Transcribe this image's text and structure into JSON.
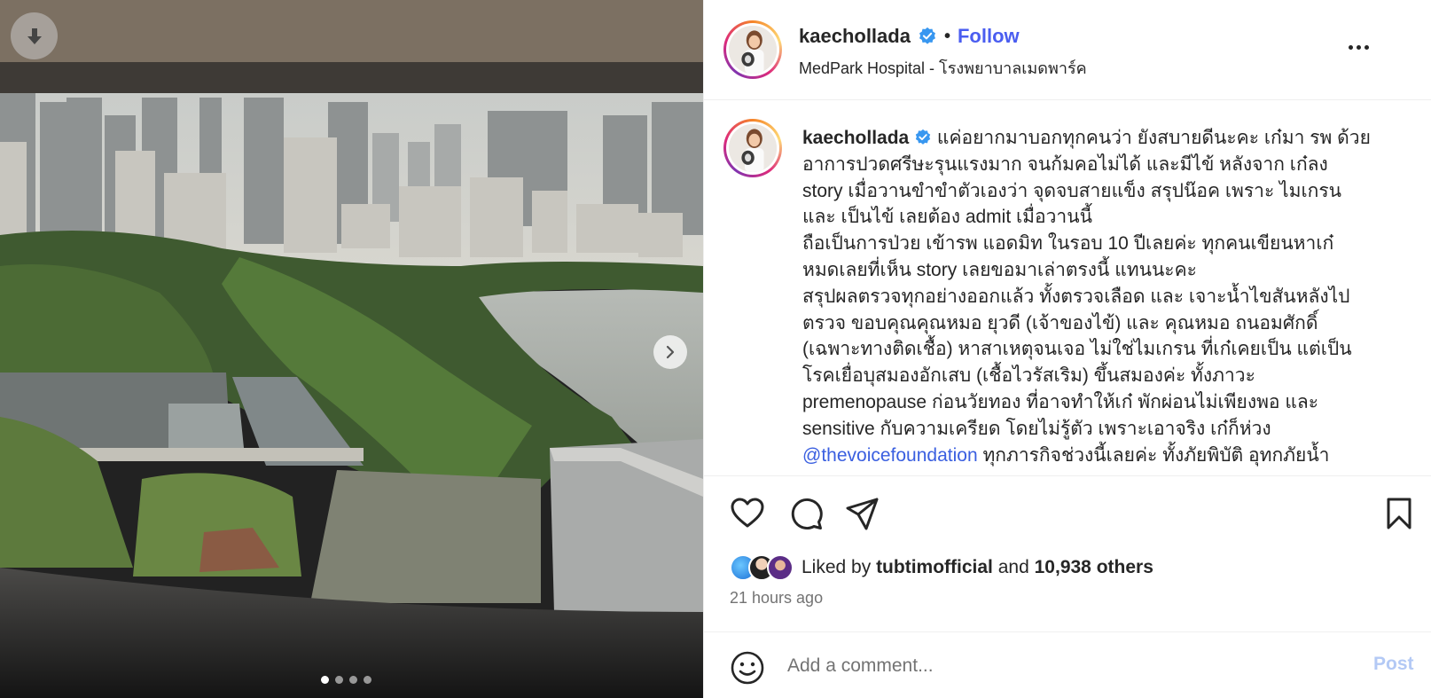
{
  "media": {
    "download_icon": "download-arrow-icon",
    "next_icon": "chevron-right-icon",
    "slide_count": 4,
    "active_slide": 1
  },
  "header": {
    "username": "kaechollada",
    "verified": true,
    "separator": "•",
    "follow_label": "Follow",
    "location": "MedPark Hospital - โรงพยาบาลเมดพาร์ค",
    "more_icon": "more-options-icon"
  },
  "caption": {
    "username": "kaechollada",
    "lines": [
      "แค่อยากมาบอกทุกคนว่า ยังสบายดีนะคะ เก๋มา รพ ด้วย",
      "อาการปวดศรีษะรุนแรงมาก จนก้มคอไม่ได้ และมีไข้ หลังจาก เก๋ลง",
      "story เมื่อวานขำขำตัวเองว่า จุดจบสายแข็ง สรุปน๊อค เพราะ ไมเกรน",
      "และ เป็นไข้ เลยต้อง admit เมื่อวานนี้",
      "ถือเป็นการป่วย เข้ารพ แอดมิท ในรอบ 10 ปีเลยค่ะ ทุกคนเขียนหาเก๋",
      "หมดเลยที่เห็น story เลยขอมาเล่าตรงนี้ แทนนะคะ",
      "สรุปผลตรวจทุกอย่างออกแล้ว ทั้งตรวจเลือด และ เจาะน้ำไขสันหลังไป",
      "ตรวจ ขอบคุณคุณหมอ ยุวดี (เจ้าของไข้) และ คุณหมอ ถนอมศักดิ์",
      "(เฉพาะทางติดเชื้อ) หาสาเหตุจนเจอ ไม่ใช่ไมเกรน ที่เก๋เคยเป็น แต่เป็น",
      "โรคเยื่อบุสมองอักเสบ (เชื้อไวรัสเริม) ขึ้นสมองค่ะ ทั้งภาวะ",
      "premenopause ก่อนวัยทอง ที่อาจทำให้เก๋ พักผ่อนไม่เพียงพอ และ",
      "sensitive กับความเครียด โดยไม่รู้ตัว เพราะเอาจริง เก๋ก็ห่วง"
    ],
    "mention": "@thevoicefoundation",
    "last_line_rest": " ทุกภารกิจช่วงนี้เลยค่ะ ทั้งภัยพิบัติ อุทกภัยน้ำ"
  },
  "actions": {
    "like_icon": "heart-icon",
    "comment_icon": "comment-icon",
    "share_icon": "share-paper-plane-icon",
    "save_icon": "bookmark-icon"
  },
  "likes": {
    "prefix": "Liked by",
    "first_liker": "tubtimofficial",
    "and": "and",
    "others": "10,938 others"
  },
  "time_ago": "21 hours ago",
  "comment": {
    "placeholder": "Add a comment...",
    "post_label": "Post",
    "emoji_icon": "emoji-smiley-icon"
  }
}
